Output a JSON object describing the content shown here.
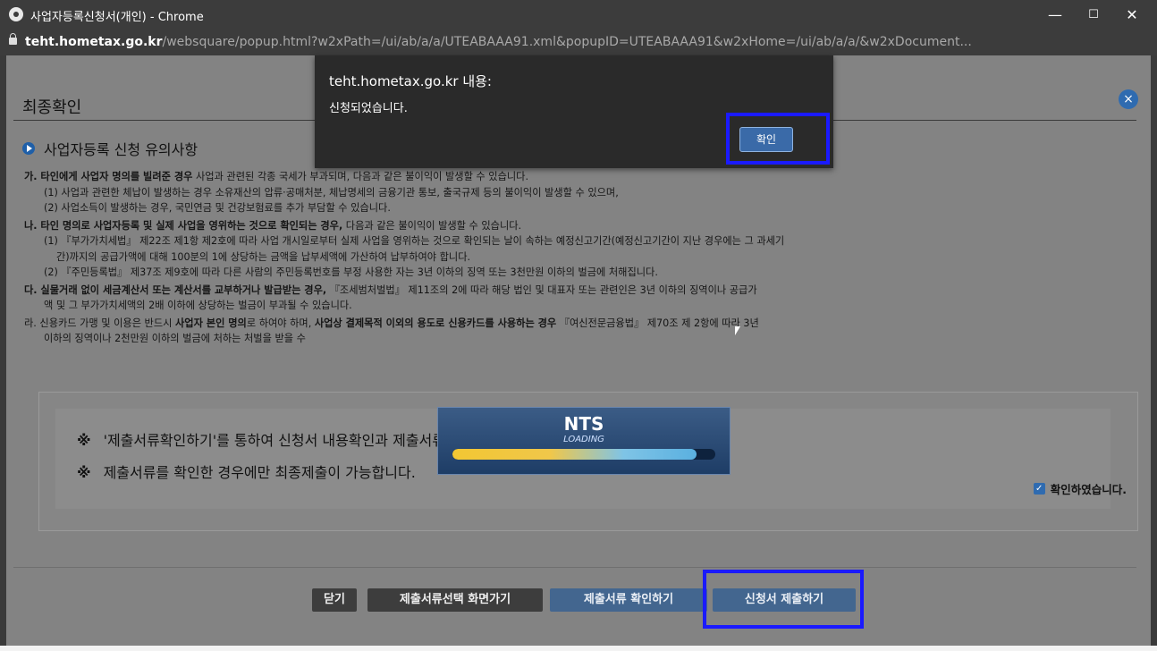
{
  "window": {
    "title": "사업자등록신청서(개인) - Chrome",
    "controls": {
      "minimize": "—",
      "maximize": "☐",
      "close": "✕"
    }
  },
  "address": {
    "host": "teht.hometax.go.kr",
    "path": "/websquare/popup.html?w2xPath=/ui/ab/a/a/UTEABAAA91.xml&popupID=UTEABAAA91&w2xHome=/ui/ab/a/a/&w2xDocument..."
  },
  "popup": {
    "title": "최종확인",
    "close": "×",
    "notice_heading": "사업자등록 신청 유의사항",
    "sections": [
      {
        "bold": "가. 타인에게 사업자 명의를 빌려준 경우",
        "text": " 사업과 관련된 각종 국세가 부과되며, 다음과 같은 불이익이 발생할 수 있습니다.",
        "items": [
          "(1) 사업과 관련한 체납이 발생하는 경우 소유재산의 압류·공매처분, 체납명세의 금융기관 통보, 출국규제 등의 불이익이 발생할 수 있으며,",
          "(2) 사업소득이 발생하는 경우, 국민연금 및 건강보험료를 추가 부담할 수 있습니다."
        ]
      },
      {
        "bold": "나. 타인 명의로 사업자등록 및 실제 사업을 영위하는 것으로 확인되는 경우,",
        "text": " 다음과 같은 불이익이 발생할 수 있습니다.",
        "items": [
          "(1) 『부가가치세법』 제22조 제1항 제2호에 따라 사업 개시일로부터 실제 사업을 영위하는 것으로 확인되는 날이 속하는 예정신고기간(예정신고기간이 지난 경우에는 그 과세기",
          "간)까지의 공급가액에 대해 100분의 1에 상당하는 금액을 납부세액에 가산하여 납부하여야 합니다.",
          "(2) 『주민등록법』 제37조 제9호에 따라 다른 사람의 주민등록번호를 부정 사용한 자는 3년 이하의 징역 또는 3천만원 이하의 벌금에 처해집니다."
        ]
      },
      {
        "bold": "다. 실물거래 없이 세금계산서 또는 계산서를 교부하거나 발급받는 경우,",
        "text": " 『조세범처벌법』 제11조의 2에 따라 해당 법인 및 대표자 또는 관련인은 3년 이하의 징역이나 공급가",
        "items": [
          "액 및 그 부가가치세액의 2배 이하에 상당하는 벌금이 부과될 수 있습니다."
        ]
      },
      {
        "pre": "라. 신용카드 가맹 및 이용은 반드시 ",
        "bold": "사업자 본인 명의",
        "text": "로 하여야 하며, ",
        "bold2": "사업상 결제목적 이외의 용도로 신용카드를 사용하는 경우",
        "text2": " 『여신전문금융법』 제70조 제 2항에 따라 3년",
        "items": [
          "이하의 징역이나 2천만원 이하의 벌금에 처하는 처벌을 받을 수"
        ]
      }
    ],
    "confirm_mark": "※",
    "confirm_line1": "'제출서류확인하기'를 통하여 신청서 내용확인과 제출서류의 누락이 없는지 확인하시기 바랍니다.",
    "confirm_line2": "제출서류를 확인한 경우에만 최종제출이 가능합니다.",
    "checkbox_label": "확인하였습니다.",
    "checkbox_checked": true,
    "buttons": {
      "close": "닫기",
      "go_select": "제출서류선택 화면가기",
      "check_docs": "제출서류 확인하기",
      "submit": "신청서 제출하기"
    }
  },
  "alert": {
    "title": "teht.hometax.go.kr 내용:",
    "message": "신청되었습니다.",
    "ok": "확인"
  },
  "loading": {
    "brand": "NTS",
    "label": "LOADING",
    "progress": 0.93
  },
  "colors": {
    "highlight": "#1a1aff",
    "accent_blue": "#2f6bb0"
  }
}
